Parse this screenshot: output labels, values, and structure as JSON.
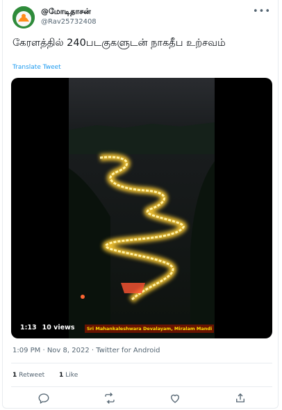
{
  "tweet": {
    "display_name": "@மோடிதாசன்",
    "handle": "@Rav25732408",
    "more_icon": "more-horizontal-icon",
    "text": "கேரளத்தில் 240படகுகளுடன் நாகதீப உற்சவம்",
    "translate_label": "Translate Tweet",
    "timestamp": "1:09 PM · Nov 8, 2022 · Twitter for Android"
  },
  "video": {
    "duration": "1:13",
    "views": "10 views",
    "caption": "Sri Mahankaleshwara Devalayam, Miralam Mandi"
  },
  "stats": {
    "retweets_count": "1",
    "retweets_label": "Retweet",
    "likes_count": "1",
    "likes_label": "Like"
  },
  "actions": [
    "reply-icon",
    "retweet-icon",
    "like-icon",
    "share-icon"
  ],
  "colors": {
    "accent": "#1d9bf0",
    "muted": "#536471",
    "glow": "#ffcc33"
  }
}
